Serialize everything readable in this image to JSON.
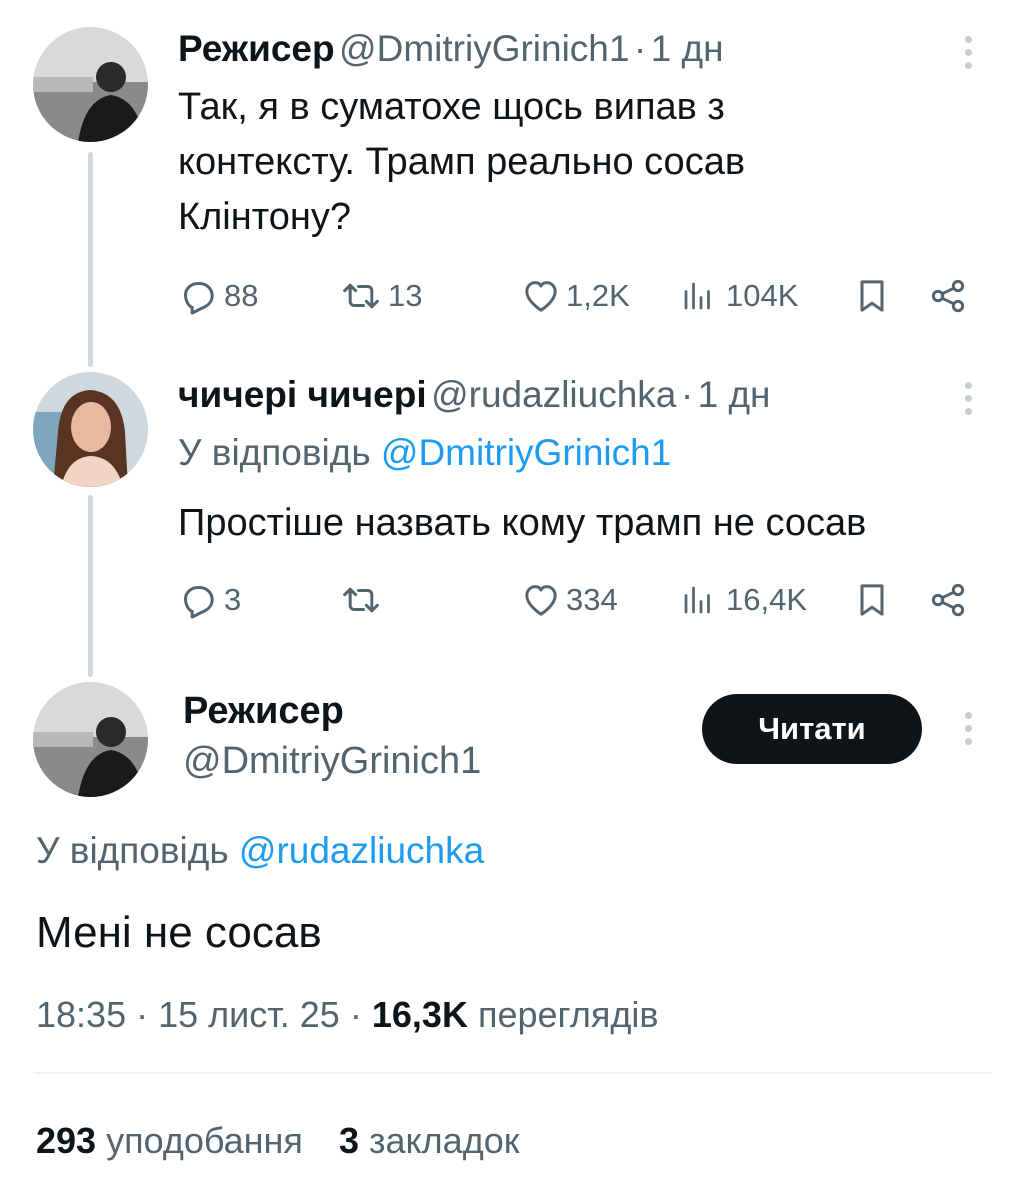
{
  "tweet1": {
    "name": "Режисер",
    "handle": "@DmitriyGrinich1",
    "sep": "·",
    "time": "1 дн",
    "text_lines": [
      "Так, я в суматохе щось випав з",
      "контексту. Трамп реально сосав",
      "Клінтону?"
    ],
    "replies": "88",
    "retweets": "13",
    "likes": "1,2K",
    "views": "104K"
  },
  "tweet2": {
    "name": "чичері чичері",
    "handle": "@rudazliuchka",
    "sep": "·",
    "time": "1 дн",
    "reply_prefix": "У відповідь",
    "reply_to": "@DmitriyGrinich1",
    "text": "Простіше назвать кому трамп не сосав",
    "replies": "3",
    "retweets": "",
    "likes": "334",
    "views": "16,4K"
  },
  "main_tweet": {
    "name": "Режисер",
    "handle": "@DmitriyGrinich1",
    "follow_label": "Читати",
    "reply_prefix": "У відповідь",
    "reply_to": "@rudazliuchka",
    "text": "Мені не сосав",
    "time": "18:35",
    "date": "15 лист. 25",
    "views_count": "16,3K",
    "views_label": "переглядів",
    "likes_count": "293",
    "likes_label": "уподобання",
    "bookmarks_count": "3",
    "bookmarks_label": "закладок"
  },
  "icons": [
    "reply-icon",
    "retweet-icon",
    "like-icon",
    "views-icon",
    "bookmark-icon",
    "share-icon",
    "more-icon"
  ],
  "colors": {
    "link": "#1d9bf0",
    "muted": "#536471",
    "button": "#0f1419",
    "thread_line": "#cfd9de"
  }
}
